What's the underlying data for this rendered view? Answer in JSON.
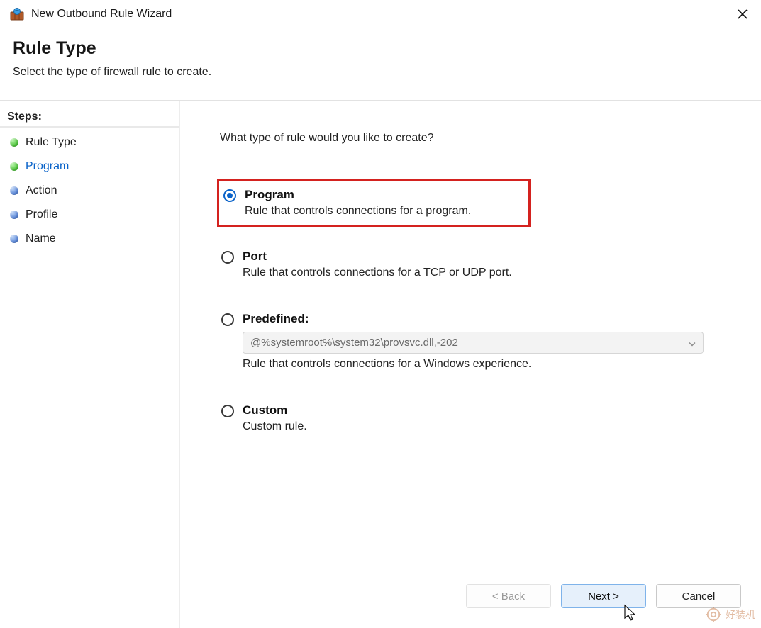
{
  "titlebar": {
    "title": "New Outbound Rule Wizard"
  },
  "header": {
    "heading": "Rule Type",
    "subheading": "Select the type of firewall rule to create."
  },
  "sidebar": {
    "heading": "Steps:",
    "items": [
      {
        "label": "Rule Type",
        "dot": "green",
        "current": false
      },
      {
        "label": "Program",
        "dot": "green",
        "current": true
      },
      {
        "label": "Action",
        "dot": "blue",
        "current": false
      },
      {
        "label": "Profile",
        "dot": "blue",
        "current": false
      },
      {
        "label": "Name",
        "dot": "blue",
        "current": false
      }
    ]
  },
  "main": {
    "prompt": "What type of rule would you like to create?",
    "options": {
      "program": {
        "title": "Program",
        "desc": "Rule that controls connections for a program.",
        "selected": true
      },
      "port": {
        "title": "Port",
        "desc": "Rule that controls connections for a TCP or UDP port.",
        "selected": false
      },
      "predefined": {
        "title": "Predefined:",
        "select_value": "@%systemroot%\\system32\\provsvc.dll,-202",
        "desc": "Rule that controls connections for a Windows experience.",
        "selected": false
      },
      "custom": {
        "title": "Custom",
        "desc": "Custom rule.",
        "selected": false
      }
    }
  },
  "footer": {
    "back": "< Back",
    "next": "Next >",
    "cancel": "Cancel"
  },
  "watermark": {
    "text": "好装机"
  }
}
